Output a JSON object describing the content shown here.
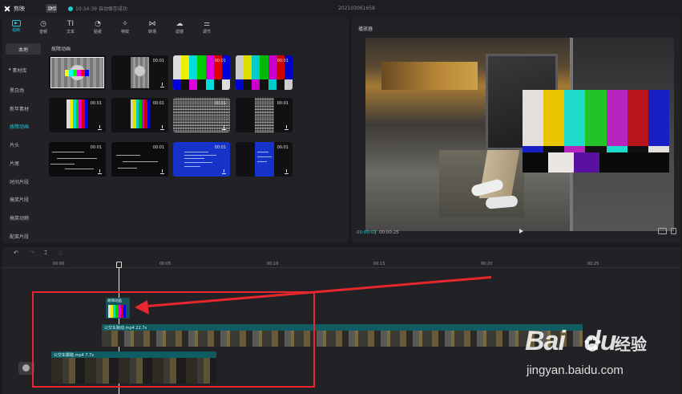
{
  "app": {
    "name": "剪映",
    "menu_label": "菜单",
    "autosave_text": "10:34:39 自动保存成功",
    "project_title": "202103061658"
  },
  "toolbar": {
    "tabs": [
      {
        "icon": "video-icon",
        "label": "视频",
        "glyph": "▭"
      },
      {
        "icon": "audio-icon",
        "label": "音频",
        "glyph": "◷"
      },
      {
        "icon": "text-icon",
        "label": "文本",
        "glyph": "TI"
      },
      {
        "icon": "sticker-icon",
        "label": "贴纸",
        "glyph": "◔"
      },
      {
        "icon": "effect-icon",
        "label": "特效",
        "glyph": "✧"
      },
      {
        "icon": "transition-icon",
        "label": "转场",
        "glyph": "⋈"
      },
      {
        "icon": "filter-icon",
        "label": "滤镜",
        "glyph": "☁"
      },
      {
        "icon": "adjust-icon",
        "label": "调节",
        "glyph": "⚌"
      }
    ]
  },
  "categories": {
    "local": "本地",
    "library": "素材库",
    "items": [
      "黑白场",
      "新年素材",
      "故障动画",
      "片头",
      "片尾",
      "时间片段",
      "搞笑片段",
      "搞笑动物",
      "配菜片段"
    ]
  },
  "grid": {
    "title": "故障动画",
    "durations": [
      "00:01",
      "00:01",
      "00:01",
      "00:01",
      "00:01",
      "00:01",
      "00:01",
      "00:01",
      "00:01",
      "00:01",
      "00:01"
    ]
  },
  "player": {
    "title": "播放器",
    "current_time": "00:00:03",
    "separator": "|",
    "total_time": "00:00:25"
  },
  "timeline": {
    "ruler": [
      "00:00",
      "00:05",
      "00:10",
      "00:15",
      "00:20",
      "00:25"
    ],
    "effect_clip_label": "故障动画",
    "main_track_label": "公交车跑动.mp4   22.7s",
    "sec_track_label": "公交车脚踏.mp4   7.7s"
  },
  "watermark": {
    "brand": "Bai",
    "brand_suffix": "du",
    "cn": "经验",
    "url": "jingyan.baidu.com"
  },
  "colors": {
    "accent": "#1ecbd6",
    "annotation": "#e7262d"
  }
}
